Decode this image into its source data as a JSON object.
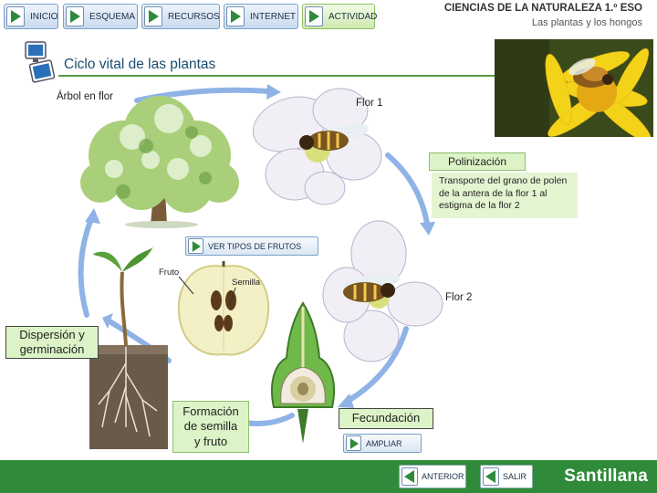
{
  "nav": {
    "buttons": [
      {
        "label": "INICIO"
      },
      {
        "label": "ESQUEMA"
      },
      {
        "label": "RECURSOS"
      },
      {
        "label": "INTERNET"
      },
      {
        "label": "ACTIVIDAD"
      }
    ]
  },
  "header": {
    "title": "CIENCIAS DE LA NATURALEZA 1.º ESO",
    "subtitle": "Las plantas y los hongos"
  },
  "section": {
    "title": "Ciclo vital de las plantas"
  },
  "diagram": {
    "tree_label": "Árbol en flor",
    "flower1_label": "Flor 1",
    "pollination_label": "Polinización",
    "pollination_desc": "Transporte del grano de polen de la antera de la flor 1 al estigma de la flor 2",
    "fruit_types_button": "VER TIPOS DE FRUTOS",
    "fruit_label": "Fruto",
    "seed_label": "Semilla",
    "flower2_label": "Flor 2",
    "dispersal_label": "Dispersión y germinación",
    "formation_label": "Formación de semilla y fruto",
    "fertilization_label": "Fecundación",
    "expand_button": "AMPLIAR"
  },
  "footer": {
    "prev_label": "ANTERIOR",
    "exit_label": "SALIR",
    "brand": "Santillana"
  },
  "colors": {
    "accent_green": "#2f8a3a",
    "label_bg": "#dbf3c6",
    "arrow_blue": "#8fb3e6",
    "title_blue": "#1b4d6e"
  }
}
